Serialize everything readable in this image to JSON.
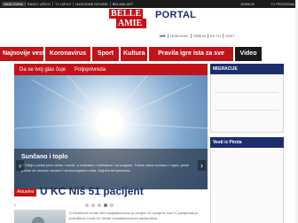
{
  "topbar": {
    "left_links": [
      "NASLOVNA",
      "RADIO UŽIVO",
      "TV UŽIVO",
      "NARODNE NOVINE",
      "BELAMI ART"
    ],
    "right_links": [
      "EMISIJE",
      "TV PROGRAM"
    ]
  },
  "logo": {
    "line1": "BELLE",
    "line2": "AMIE",
    "portal": "PORTAL"
  },
  "city_links": [
    "NIŠ",
    "LESKOVAC",
    "SRBIJA",
    "EX-YU",
    "SVET"
  ],
  "main_nav": [
    "Najnovije vesti",
    "Koronavirus",
    "Sport",
    "Kultura",
    "Pravila igre ista za sve",
    "Video"
  ],
  "sub_nav": [
    "Da se tvoj glas čuje",
    "Poljoprivreda"
  ],
  "hero": {
    "title": "Sunčano i toplo",
    "description": "U Srbiji u petak jutro vedro i sveže, u dolinama i kotlinama i sa maglom. Tokom dana sunčano i toplo, posle podne do umeren severni i severozapadni vetar. Najniža temperatura",
    "slides": 5,
    "active_slide": 3
  },
  "article": {
    "badge": "Aktuelno",
    "headline": "U KC Niš 51 pacijent",
    "meta": "0",
    "text": "U Kliničkom centru Niš hospitalizovano je ukupno 51 pacijent, kod 11 pacijenata je potvrđena Covid-19. Među hospitalizovanim pacijentima"
  },
  "sidebar": {
    "section1_title": "MIGRACIJE",
    "section2_title": "Vesti iz Pirota"
  }
}
